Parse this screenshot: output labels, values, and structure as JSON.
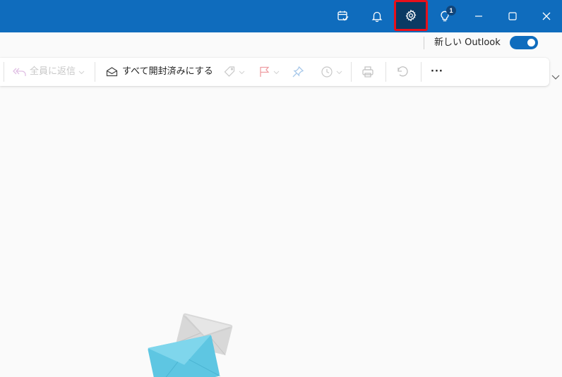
{
  "titlebar": {
    "background": "#0f6cbd",
    "icons": [
      "calendar-check-icon",
      "bell-icon",
      "gear-icon",
      "lightbulb-icon",
      "minimize-icon",
      "maximize-icon",
      "close-icon"
    ],
    "tips_badge_count": "1",
    "highlight_color": "#e8101a"
  },
  "new_outlook": {
    "label": "新しい Outlook",
    "enabled": true
  },
  "ribbon": {
    "reply_all_label": "全員に返信",
    "mark_all_read_label": "すべて開封済みにする",
    "more_label": "···"
  }
}
